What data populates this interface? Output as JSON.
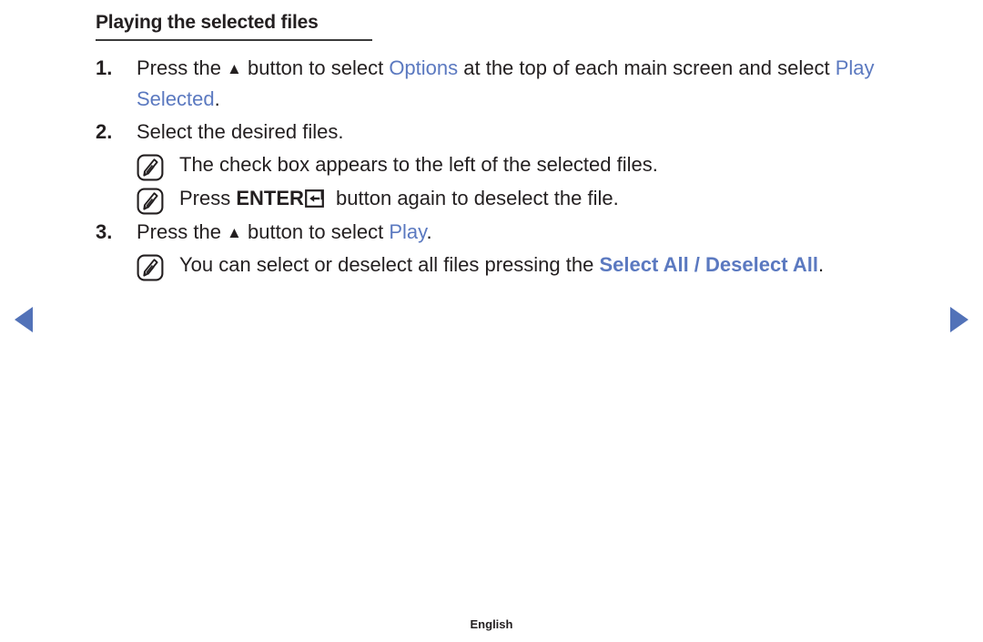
{
  "title": "Playing the selected files",
  "colors": {
    "accent_blue": "#5b79c0",
    "nav_arrow_blue": "#5272b8",
    "text": "#231f20"
  },
  "steps": [
    {
      "number": "1.",
      "parts": [
        {
          "type": "text",
          "value": "Press the "
        },
        {
          "type": "glyph",
          "value": "▲",
          "name": "up-triangle-icon"
        },
        {
          "type": "text",
          "value": " button to select "
        },
        {
          "type": "blue",
          "value": "Options"
        },
        {
          "type": "text",
          "value": " at the top of each main screen and select "
        },
        {
          "type": "blue",
          "value": "Play Selected"
        },
        {
          "type": "text",
          "value": "."
        }
      ]
    },
    {
      "number": "2.",
      "parts": [
        {
          "type": "text",
          "value": "Select the desired files."
        }
      ]
    },
    {
      "number": "3.",
      "parts": [
        {
          "type": "text",
          "value": "Press the "
        },
        {
          "type": "glyph",
          "value": "▲",
          "name": "up-triangle-icon"
        },
        {
          "type": "text",
          "value": " button to select "
        },
        {
          "type": "blue",
          "value": "Play"
        },
        {
          "type": "text",
          "value": "."
        }
      ]
    }
  ],
  "notes": [
    {
      "after_step": "2",
      "icon": "note-pencil-icon",
      "parts": [
        {
          "type": "text",
          "value": "The check box appears to the left of the selected files."
        }
      ]
    },
    {
      "after_step": "2",
      "icon": "note-pencil-icon",
      "parts": [
        {
          "type": "text",
          "value": "Press "
        },
        {
          "type": "bold",
          "value": "ENTER"
        },
        {
          "type": "enterkey",
          "value": "",
          "name": "enter-key-icon"
        },
        {
          "type": "text",
          "value": " button again to deselect the file."
        }
      ]
    },
    {
      "after_step": "3",
      "icon": "note-pencil-icon",
      "parts": [
        {
          "type": "text",
          "value": "You can select or deselect all files pressing the "
        },
        {
          "type": "blue-bold",
          "value": "Select All / Deselect All"
        },
        {
          "type": "text",
          "value": "."
        }
      ]
    }
  ],
  "navigation": {
    "prev_label": "Previous page",
    "next_label": "Next page"
  },
  "footer": {
    "language": "English"
  }
}
